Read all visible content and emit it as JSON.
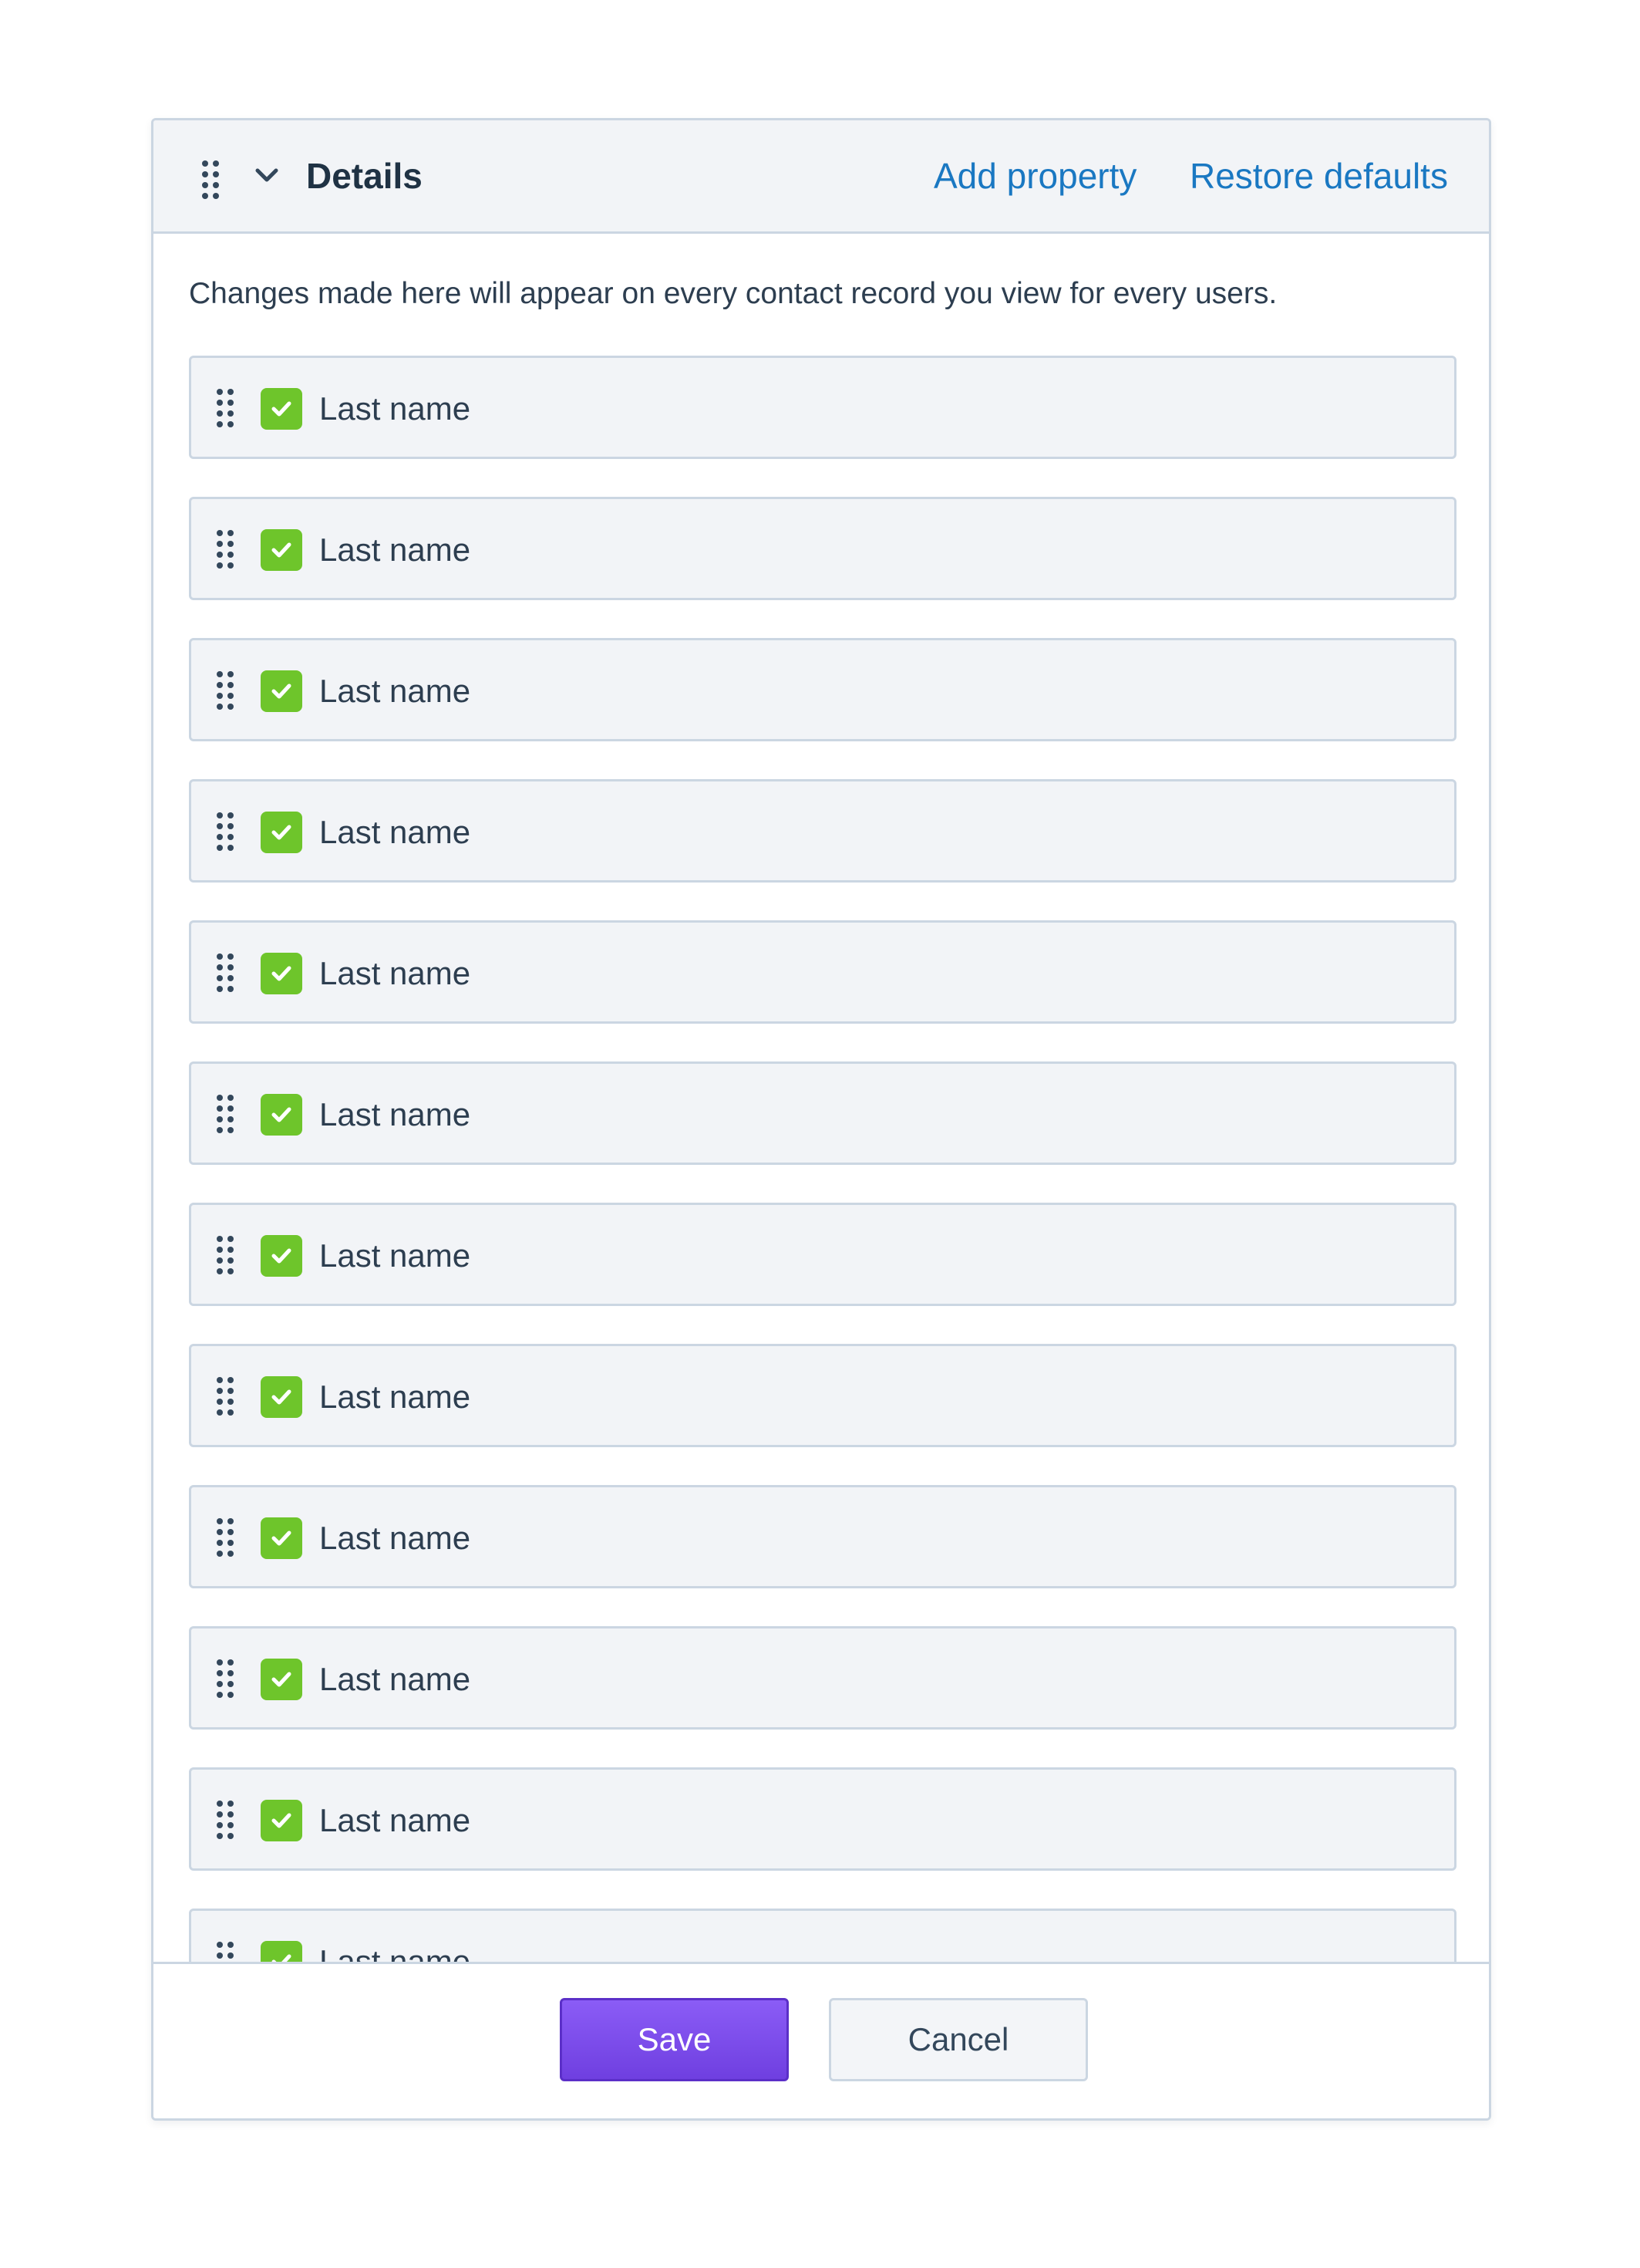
{
  "panel": {
    "title": "Details",
    "add_property_label": "Add property",
    "restore_defaults_label": "Restore defaults",
    "info_text": "Changes made here will appear on every contact record you view for every users."
  },
  "properties": [
    {
      "label": "Last name",
      "checked": true
    },
    {
      "label": "Last name",
      "checked": true
    },
    {
      "label": "Last name",
      "checked": true
    },
    {
      "label": "Last name",
      "checked": true
    },
    {
      "label": "Last name",
      "checked": true
    },
    {
      "label": "Last name",
      "checked": true
    },
    {
      "label": "Last name",
      "checked": true
    },
    {
      "label": "Last name",
      "checked": true
    },
    {
      "label": "Last name",
      "checked": true
    },
    {
      "label": "Last name",
      "checked": true
    },
    {
      "label": "Last name",
      "checked": true
    },
    {
      "label": "Last name",
      "checked": true
    }
  ],
  "footer": {
    "save_label": "Save",
    "cancel_label": "Cancel"
  },
  "colors": {
    "link": "#1a78c2",
    "check": "#6ec52b",
    "primary": "#7c4de6"
  },
  "icons": {
    "header_grip": "drag-handle-icon",
    "chevron": "chevron-down-icon",
    "row_grip": "drag-handle-icon",
    "checkbox": "checkmark-icon"
  }
}
